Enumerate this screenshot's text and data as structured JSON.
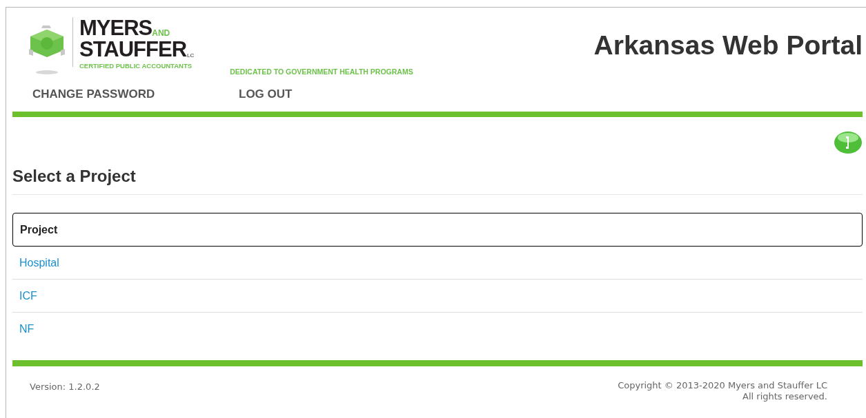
{
  "logo": {
    "name_line_1": "MYERS",
    "and": "AND",
    "name_line_2": "STAUFFER",
    "suffix": "LC",
    "subtitle": "CERTIFIED PUBLIC ACCOUNTANTS"
  },
  "tagline": "DEDICATED TO GOVERNMENT HEALTH PROGRAMS",
  "title": "Arkansas Web Portal",
  "nav": [
    "CHANGE PASSWORD",
    "LOG OUT"
  ],
  "heading": "Select a Project",
  "table": {
    "columns": [
      "Project"
    ],
    "rows": [
      [
        "Hospital"
      ],
      [
        "ICF"
      ],
      [
        "NF"
      ]
    ]
  },
  "footer": {
    "version": "Version: 1.2.0.2",
    "copyright": "Copyright © 2013-2020 Myers and Stauffer LC",
    "rights": "All rights reserved."
  }
}
